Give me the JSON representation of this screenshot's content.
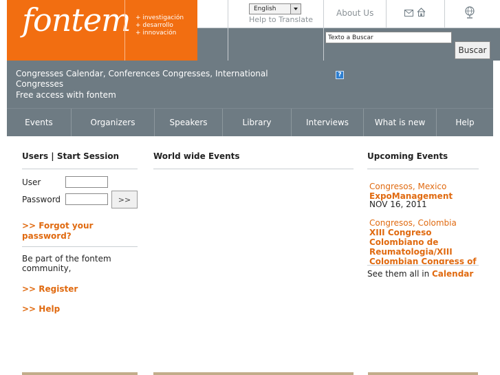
{
  "header": {
    "logo_text": "fontem",
    "tagline": [
      "+ investigación",
      "+ desarrollo",
      "+ innovación"
    ],
    "language": "English",
    "help_translate": "Help to Translate",
    "about_us": "About Us",
    "icons": [
      "mail-icon",
      "home-icon",
      "globe-icon"
    ],
    "search": {
      "value": "Texto a Buscar",
      "button": "Buscar"
    }
  },
  "intro": {
    "title": "Congresses Calendar, Conferences Congresses, International Congresses",
    "subtitle": "Free access with fontem",
    "help_badge": "?"
  },
  "nav": [
    "Events",
    "Organizers",
    "Speakers",
    "Library",
    "Interviews",
    "What is new",
    "Help"
  ],
  "login": {
    "title": "Users | Start Session",
    "user_label": "User",
    "password_label": "Password",
    "submit": ">>",
    "forgot": ">> Forgot your password?",
    "community": "Be part of the fontem community,",
    "register": ">> Register",
    "help": ">> Help"
  },
  "main": {
    "title": "World wide Events"
  },
  "upcoming": {
    "title": "Upcoming Events",
    "events": [
      {
        "category": "Congresos, Mexico",
        "title": "ExpoManagement",
        "date": "NOV 16, 2011"
      },
      {
        "category": "Congresos, Colombia",
        "title": "XIII Congreso Colombiano de Reumatologia/XIII Colombian Congress of"
      }
    ],
    "see_all": "See them all in",
    "calendar": "Calendar"
  },
  "colors": {
    "orange": "#f26e11",
    "slate": "#6e7b83",
    "link": "#e06a10"
  }
}
